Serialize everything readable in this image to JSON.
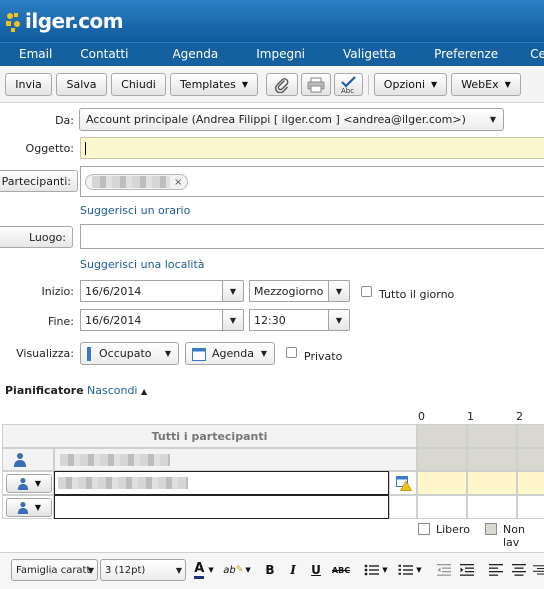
{
  "brand": {
    "logo_text": "ilger.com"
  },
  "nav": [
    "Email",
    "Contatti",
    "Agenda",
    "Impegni",
    "Valigetta",
    "Preferenze",
    "Cerca"
  ],
  "toolbar": {
    "send": "Invia",
    "save": "Salva",
    "close": "Chiudi",
    "templates": "Templates",
    "options": "Opzioni",
    "webex": "WebEx",
    "icons": [
      "paperclip-icon",
      "print-icon",
      "spellcheck-icon"
    ],
    "spellcheck_text": "Abc"
  },
  "form": {
    "from_label": "Da:",
    "from_value": "Account principale (Andrea Filippi [ ilger.com ] <andrea@ilger.com>)",
    "subject_label": "Oggetto:",
    "subject_value": "",
    "attendees_label": "Partecipanti:",
    "suggest_time": "Suggerisci un orario",
    "location_label": "Luogo:",
    "suggest_location": "Suggerisci una località",
    "start_label": "Inizio:",
    "start_date": "16/6/2014",
    "start_time": "Mezzogiorno",
    "all_day": "Tutto il giorno",
    "end_label": "Fine:",
    "end_date": "16/6/2014",
    "end_time": "12:30",
    "show_label": "Visualizza:",
    "show_as": "Occupato",
    "calendar": "Agenda",
    "private": "Privato",
    "status_color": "#3a78c9"
  },
  "scheduler": {
    "title": "Pianificatore",
    "hide": "Nascondi",
    "all_attendees": "Tutti i partecipanti",
    "hours": [
      "0",
      "1",
      "2"
    ],
    "legend_free": "Libero",
    "legend_work": "Non lav",
    "free_color": "#ffffff",
    "nonwork_color": "#d8d8d0",
    "busy_color": "#fff6cc"
  },
  "editor": {
    "font_family": "Famiglia caratt",
    "font_size": "3 (12pt)",
    "font_color_letter": "A",
    "highlight_text": "ab",
    "bold": "B",
    "italic": "I",
    "underline": "U",
    "strike": "ABC"
  }
}
